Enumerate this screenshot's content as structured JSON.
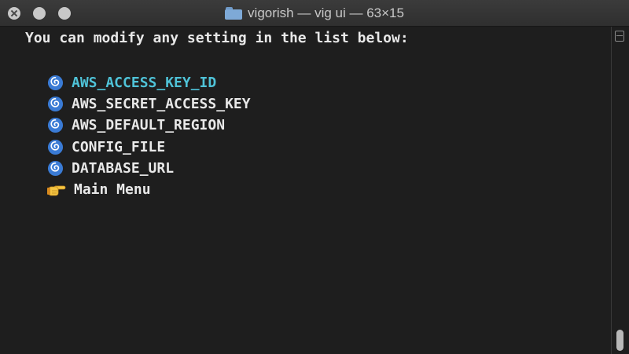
{
  "window": {
    "title": "vigorish — vig ui — 63×15",
    "folder_icon": "folder-icon"
  },
  "terminal": {
    "prompt": "You can modify any setting in the list below:",
    "menu": [
      {
        "label": "AWS_ACCESS_KEY_ID",
        "icon": "cyclone-icon",
        "selected": true
      },
      {
        "label": "AWS_SECRET_ACCESS_KEY",
        "icon": "cyclone-icon",
        "selected": false
      },
      {
        "label": "AWS_DEFAULT_REGION",
        "icon": "cyclone-icon",
        "selected": false
      },
      {
        "label": "CONFIG_FILE",
        "icon": "cyclone-icon",
        "selected": false
      },
      {
        "label": "DATABASE_URL",
        "icon": "cyclone-icon",
        "selected": false
      },
      {
        "label": "Main Menu",
        "icon": "pointing-hand-icon",
        "selected": false
      }
    ]
  },
  "colors": {
    "background": "#1e1e1e",
    "text": "#e8e8e8",
    "selected_text": "#4fc3d8",
    "icon_blue": "#3a7bd5"
  }
}
